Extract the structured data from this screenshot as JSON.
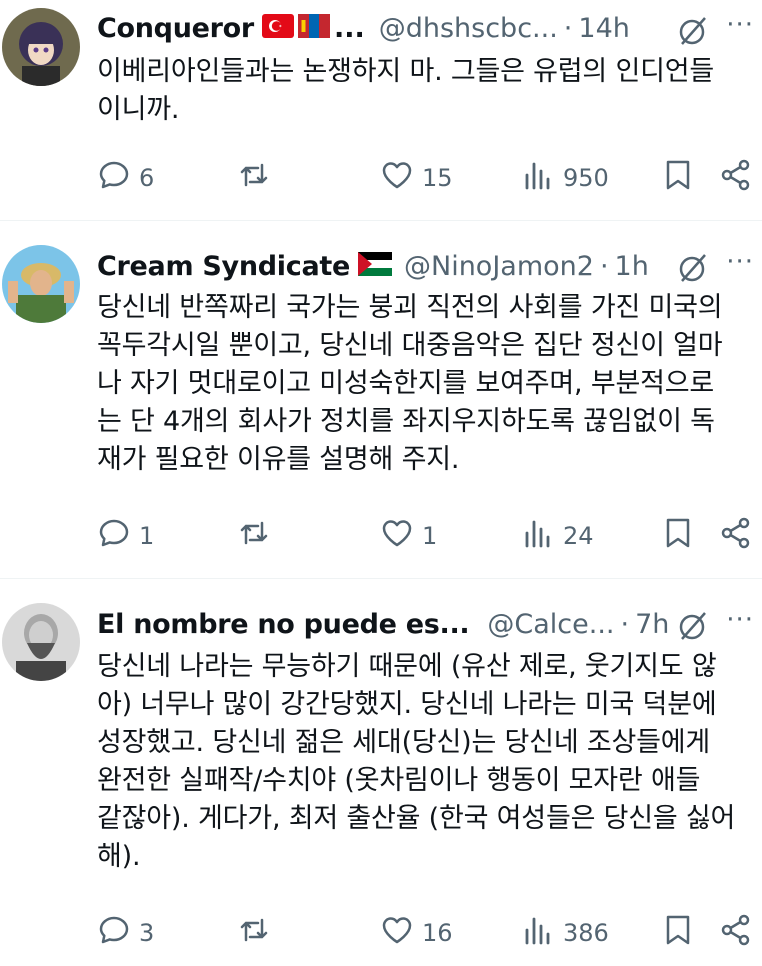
{
  "tweets": [
    {
      "name": "Conqueror",
      "ellipsis": "...",
      "handle": "@dhshscbc...",
      "dot": "·",
      "time": "14h",
      "more": "···",
      "body_lines": [
        "이베리아인들과는 논쟁하지 마. 그들은 유럽의 인디언들",
        "이니까."
      ],
      "replies": "6",
      "retweets": "",
      "likes": "15",
      "views": "950"
    },
    {
      "name": "Cream Syndicate",
      "handle": "@NinoJamon2",
      "dot": "·",
      "time": "1h",
      "more": "···",
      "body_lines": [
        "당신네 반쪽짜리 국가는 붕괴 직전의 사회를 가진 미국의",
        "꼭두각시일 뿐이고, 당신네 대중음악은 집단 정신이 얼마",
        "나 자기 멋대로이고 미성숙한지를 보여주며, 부분적으로",
        "는 단 4개의 회사가 정치를 좌지우지하도록 끊임없이 독",
        "재가 필요한 이유를 설명해 주지."
      ],
      "replies": "1",
      "retweets": "",
      "likes": "1",
      "views": "24"
    },
    {
      "name": "El nombre no puede es...",
      "handle": "@Calce...",
      "dot": "·",
      "time": "7h",
      "more": "···",
      "body_lines": [
        "당신네 나라는 무능하기 때문에 (유산 제로, 웃기지도 않",
        "아) 너무나 많이 강간당했지. 당신네 나라는 미국 덕분에",
        "성장했고. 당신네 젊은 세대(당신)는 당신네 조상들에게",
        "완전한 실패작/수치야 (옷차림이나 행동이 모자란 애들",
        "같잖아). 게다가, 최저 출산율 (한국 여성들은 당신을 싫어",
        "해)."
      ],
      "replies": "3",
      "retweets": "",
      "likes": "16",
      "views": "386"
    }
  ],
  "colors": {
    "text": "#0f1419",
    "muted": "#536471",
    "divider": "#eff3f4"
  },
  "icons": [
    "reply-icon",
    "retweet-icon",
    "like-icon",
    "views-icon",
    "bookmark-icon",
    "share-icon",
    "grok-icon",
    "more-icon"
  ]
}
